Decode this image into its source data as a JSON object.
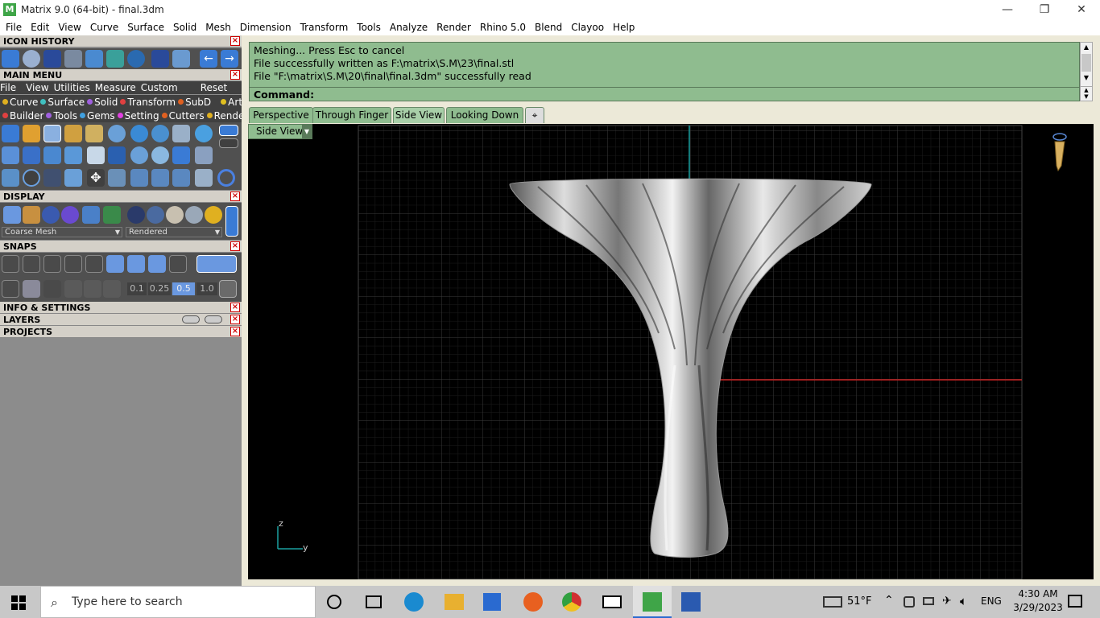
{
  "window": {
    "title": "Matrix 9.0 (64-bit) - final.3dm",
    "app_icon": "matrix-app-icon",
    "min_glyph": "—",
    "max_glyph": "❐",
    "close_glyph": "✕"
  },
  "menubar": [
    "File",
    "Edit",
    "View",
    "Curve",
    "Surface",
    "Solid",
    "Mesh",
    "Dimension",
    "Transform",
    "Tools",
    "Analyze",
    "Render",
    "Rhino 5.0",
    "Blend",
    "Clayoo",
    "Help"
  ],
  "left_panel": {
    "icon_history_title": "ICON HISTORY",
    "main_menu_title": "MAIN MENU",
    "main_menu_links": [
      "File",
      "View",
      "Utilities",
      "Measure",
      "Custom"
    ],
    "main_menu_reset": "Reset",
    "category_row1": [
      {
        "label": "Curve",
        "color": "#e0b020"
      },
      {
        "label": "Surface",
        "color": "#40c0c0"
      },
      {
        "label": "Solid",
        "color": "#a060e0"
      },
      {
        "label": "Transform",
        "color": "#e04040"
      },
      {
        "label": "SubD",
        "color": "#e06020"
      },
      {
        "label": "Art",
        "color": "#e0c020"
      }
    ],
    "category_row2": [
      {
        "label": "Builder",
        "color": "#e04040"
      },
      {
        "label": "Tools",
        "color": "#a060e0"
      },
      {
        "label": "Gems",
        "color": "#40a0e0"
      },
      {
        "label": "Setting",
        "color": "#e040e0"
      },
      {
        "label": "Cutters",
        "color": "#e06020"
      },
      {
        "label": "Render",
        "color": "#e0b020"
      }
    ],
    "display_title": "DISPLAY",
    "display_mesh_select": "Coarse Mesh",
    "display_mode_select": "Rendered",
    "snaps_title": "SNAPS",
    "snap_values": [
      "0.1",
      "0.25",
      "0.5",
      "1.0"
    ],
    "info_title": "INFO & SETTINGS",
    "layers_title": "LAYERS",
    "projects_title": "PROJECTS"
  },
  "command": {
    "history": [
      "Meshing... Press Esc to cancel",
      "File successfully written as F:\\matrix\\S.M\\23\\final.stl",
      "File \"F:\\matrix\\S.M\\20\\final\\final.3dm\" successfully read"
    ],
    "prompt": "Command:"
  },
  "view_tabs": [
    "Perspective",
    "Through Finger",
    "Side View",
    "Looking Down"
  ],
  "active_tab": "Side View",
  "viewport": {
    "label": "Side View",
    "axis_z": "z",
    "axis_y": "y",
    "colors": {
      "grid": "#3a3a3a",
      "y_axis": "#1aa0a0",
      "x_axis": "#c02020"
    }
  },
  "taskbar": {
    "search_placeholder": "Type here to search",
    "weather": "51°F",
    "language": "ENG",
    "time": "4:30 AM",
    "date": "3/29/2023"
  }
}
